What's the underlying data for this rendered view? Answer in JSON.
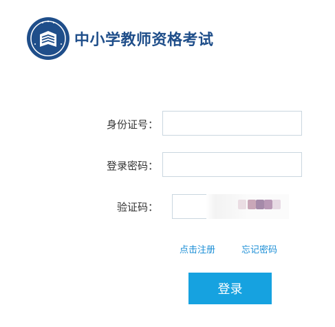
{
  "header": {
    "title": "中小学教师资格考试",
    "logo_name": "teacher-qualification-exam-logo"
  },
  "form": {
    "id_label": "身份证号：",
    "password_label": "登录密码：",
    "captcha_label": "验证码："
  },
  "links": {
    "register": "点击注册",
    "forgot_password": "忘记密码"
  },
  "actions": {
    "login": "登录"
  },
  "colors": {
    "brand": "#1f4e8a",
    "accent": "#16a2e0",
    "link": "#1b8ed6",
    "input_border": "#c9d6df"
  }
}
